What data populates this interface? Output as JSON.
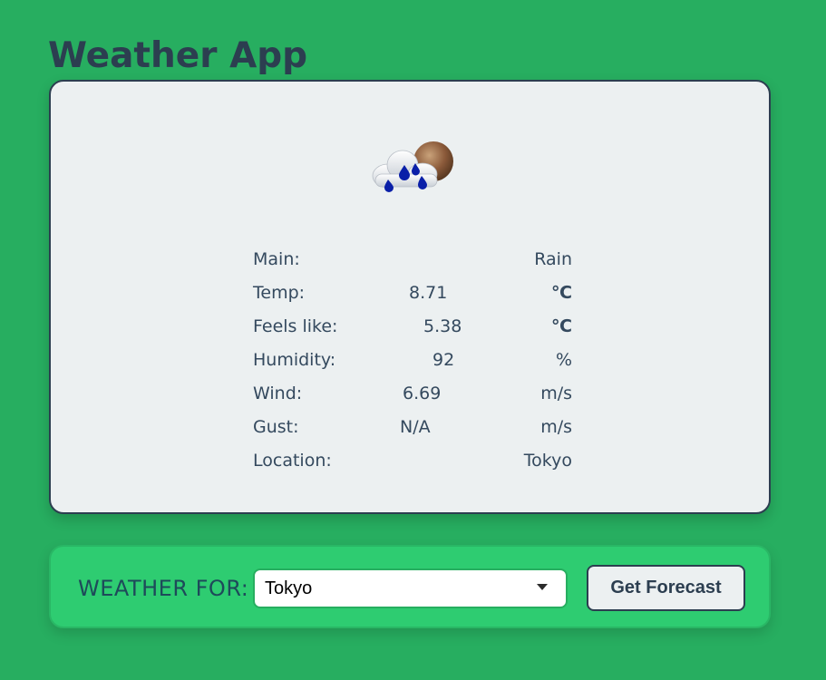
{
  "app": {
    "title": "Weather App"
  },
  "weather": {
    "icon": "rain-cloud-with-sun-icon",
    "rows": [
      {
        "label": "Main:",
        "value": "",
        "unit": "Rain"
      },
      {
        "label": "Temp:",
        "value": "8.71",
        "unit": "℃"
      },
      {
        "label": "Feels like:",
        "value": "5.38",
        "unit": "℃"
      },
      {
        "label": "Humidity:",
        "value": "92",
        "unit": "%"
      },
      {
        "label": "Wind:",
        "value": "6.69",
        "unit": "m/s"
      },
      {
        "label": "Gust:",
        "value": "N/A",
        "unit": "m/s"
      },
      {
        "label": "Location:",
        "value": "",
        "unit": "Tokyo"
      }
    ]
  },
  "controls": {
    "weather_for_label": "WEATHER FOR:",
    "selected_city": "Tokyo",
    "forecast_button_label": "Get Forecast"
  },
  "colors": {
    "page_background": "#27ae60",
    "card_background": "#ecf0f1",
    "control_bar_background": "#2ecc71",
    "text_dark": "#2c3e50",
    "raindrop_blue": "#0a1fa8"
  }
}
